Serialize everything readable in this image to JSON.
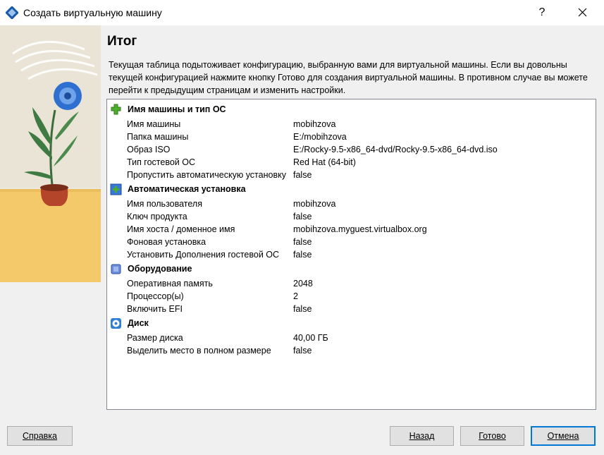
{
  "window": {
    "title": "Создать виртуальную машину",
    "help_label": "?"
  },
  "page": {
    "title": "Итог",
    "description": "Текущая таблица подытоживает конфигурацию, выбранную вами для виртуальной машины. Если вы довольны текущей конфигурацией нажмите кнопку Готово для создания виртуальной машины. В противном случае вы можете перейти к предыдущим страницам и изменить настройки."
  },
  "summary": {
    "groups": [
      {
        "title": "Имя машины и тип ОС",
        "icon": "puzzle-icon",
        "rows": [
          {
            "key": "Имя машины",
            "value": "mobihzova"
          },
          {
            "key": "Папка машины",
            "value": "E:/mobihzova"
          },
          {
            "key": "Образ ISO",
            "value": "E:/Rocky-9.5-x86_64-dvd/Rocky-9.5-x86_64-dvd.iso"
          },
          {
            "key": "Тип гостевой ОС",
            "value": "Red Hat (64-bit)"
          },
          {
            "key": "Пропустить автоматическую установку",
            "value": "false"
          }
        ]
      },
      {
        "title": "Автоматическая установка",
        "icon": "auto-install-icon",
        "rows": [
          {
            "key": "Имя пользователя",
            "value": "mobihzova"
          },
          {
            "key": "Ключ продукта",
            "value": "false"
          },
          {
            "key": "Имя хоста / доменное имя",
            "value": "mobihzova.myguest.virtualbox.org"
          },
          {
            "key": "Фоновая установка",
            "value": "false"
          },
          {
            "key": "Установить Дополнения гостевой ОС",
            "value": "false"
          }
        ]
      },
      {
        "title": "Оборудование",
        "icon": "hardware-icon",
        "rows": [
          {
            "key": "Оперативная память",
            "value": "2048"
          },
          {
            "key": "Процессор(ы)",
            "value": "2"
          },
          {
            "key": "Включить EFI",
            "value": "false"
          }
        ]
      },
      {
        "title": "Диск",
        "icon": "disk-icon",
        "rows": [
          {
            "key": "Размер диска",
            "value": "40,00 ГБ"
          },
          {
            "key": "Выделить место в полном размере",
            "value": "false"
          }
        ]
      }
    ]
  },
  "buttons": {
    "help": "Справка",
    "back": "Назад",
    "finish": "Готово",
    "cancel": "Отмена"
  },
  "colors": {
    "accent": "#0078d7",
    "group_green": "#4caf2a",
    "group_blue": "#3a78d8"
  }
}
